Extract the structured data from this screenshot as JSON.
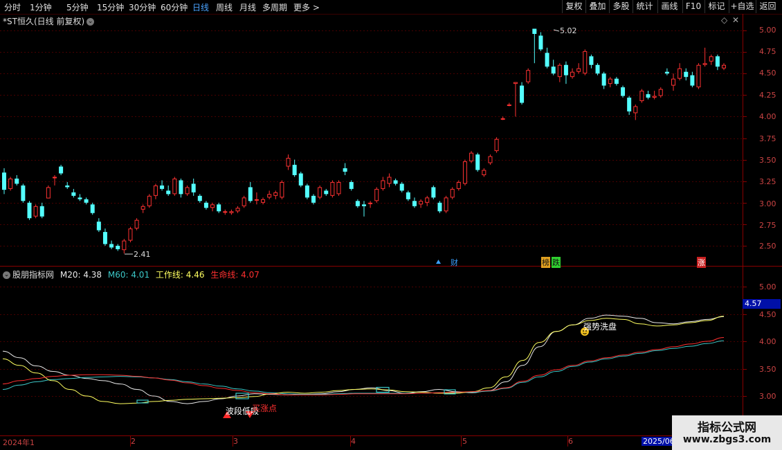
{
  "toolbar": {
    "tabs": [
      "分时",
      "1分钟",
      "5分钟",
      "15分钟",
      "30分钟",
      "60分钟",
      "日线",
      "周线",
      "月线",
      "多周期",
      "更多 >"
    ],
    "active_tab": "日线",
    "right_buttons": [
      "复权",
      "叠加",
      "多股",
      "统计",
      "画线",
      "F10",
      "标记",
      "+自选",
      "返回"
    ]
  },
  "chart_header": {
    "title": "*ST恒久(日线 前复权)",
    "right_icons": [
      "diamond-icon",
      "close-icon"
    ]
  },
  "price_axis": {
    "labels": [
      "5.00",
      "4.75",
      "4.50",
      "4.25",
      "4.00",
      "3.75",
      "3.50",
      "3.25",
      "3.00",
      "2.75",
      "2.50"
    ]
  },
  "indicator_axis": {
    "labels": [
      "5.00",
      "4.50",
      "4.00",
      "3.50",
      "3.00"
    ],
    "current_value": "4.57"
  },
  "annotations": {
    "high_label": "5.02",
    "low_label": "2.41",
    "events": [
      "财",
      "榜",
      "跌",
      "涨"
    ],
    "indicator_signals": [
      "强势洗盘",
      "波段低吸",
      "买涨点"
    ]
  },
  "indicator": {
    "name": "股朋指标网",
    "m20_label": "M20: 4.38",
    "m60_label": "M60: 4.01",
    "work_label": "工作线: 4.46",
    "life_label": "生命线: 4.07"
  },
  "date_axis": {
    "labels": [
      "2024年1",
      "2",
      "3",
      "4",
      "5",
      "6",
      "2025/06"
    ]
  },
  "watermark": {
    "title": "指标公式网",
    "url": "www.zbgs3.com"
  },
  "colors": {
    "up": "#ff3232",
    "down": "#54ffff",
    "bg": "#000000",
    "grid": "#4a0000",
    "m20": "#e8e8e8",
    "m60": "#3cc8c8",
    "work": "#ffff60",
    "life": "#ff3030"
  },
  "chart_data": {
    "type": "candlestick",
    "ylim": [
      2.4,
      5.1
    ],
    "candles": [
      {
        "o": 3.35,
        "h": 3.4,
        "l": 3.1,
        "c": 3.15
      },
      {
        "o": 3.16,
        "h": 3.3,
        "l": 3.14,
        "c": 3.28
      },
      {
        "o": 3.28,
        "h": 3.32,
        "l": 3.2,
        "c": 3.22
      },
      {
        "o": 3.2,
        "h": 3.22,
        "l": 3.0,
        "c": 3.02
      },
      {
        "o": 3.0,
        "h": 3.02,
        "l": 2.8,
        "c": 2.82
      },
      {
        "o": 2.84,
        "h": 2.98,
        "l": 2.82,
        "c": 2.96
      },
      {
        "o": 2.96,
        "h": 3.0,
        "l": 2.82,
        "c": 2.84
      },
      {
        "o": 3.05,
        "h": 3.2,
        "l": 3.05,
        "c": 3.18
      },
      {
        "o": 3.3,
        "h": 3.32,
        "l": 3.2,
        "c": 3.3
      },
      {
        "o": 3.42,
        "h": 3.44,
        "l": 3.32,
        "c": 3.34
      },
      {
        "o": 3.2,
        "h": 3.24,
        "l": 3.16,
        "c": 3.18
      },
      {
        "o": 3.12,
        "h": 3.16,
        "l": 3.06,
        "c": 3.08
      },
      {
        "o": 3.06,
        "h": 3.1,
        "l": 3.02,
        "c": 3.04
      },
      {
        "o": 3.04,
        "h": 3.06,
        "l": 2.98,
        "c": 3.0
      },
      {
        "o": 2.98,
        "h": 3.0,
        "l": 2.86,
        "c": 2.88
      },
      {
        "o": 2.78,
        "h": 2.82,
        "l": 2.66,
        "c": 2.68
      },
      {
        "o": 2.66,
        "h": 2.7,
        "l": 2.5,
        "c": 2.52
      },
      {
        "o": 2.52,
        "h": 2.56,
        "l": 2.46,
        "c": 2.48
      },
      {
        "o": 2.5,
        "h": 2.52,
        "l": 2.44,
        "c": 2.46
      },
      {
        "o": 2.45,
        "h": 2.58,
        "l": 2.41,
        "c": 2.56
      },
      {
        "o": 2.56,
        "h": 2.72,
        "l": 2.54,
        "c": 2.7
      },
      {
        "o": 2.7,
        "h": 2.82,
        "l": 2.68,
        "c": 2.8
      },
      {
        "o": 2.92,
        "h": 2.98,
        "l": 2.88,
        "c": 2.96
      },
      {
        "o": 2.96,
        "h": 3.1,
        "l": 2.94,
        "c": 3.08
      },
      {
        "o": 3.08,
        "h": 3.22,
        "l": 3.04,
        "c": 3.2
      },
      {
        "o": 3.2,
        "h": 3.26,
        "l": 3.14,
        "c": 3.16
      },
      {
        "o": 3.14,
        "h": 3.2,
        "l": 3.08,
        "c": 3.1
      },
      {
        "o": 3.1,
        "h": 3.3,
        "l": 3.08,
        "c": 3.28
      },
      {
        "o": 3.26,
        "h": 3.28,
        "l": 3.06,
        "c": 3.1
      },
      {
        "o": 3.1,
        "h": 3.2,
        "l": 3.08,
        "c": 3.18
      },
      {
        "o": 3.22,
        "h": 3.28,
        "l": 3.08,
        "c": 3.12
      },
      {
        "o": 3.08,
        "h": 3.1,
        "l": 3.0,
        "c": 3.02
      },
      {
        "o": 3.0,
        "h": 3.02,
        "l": 2.92,
        "c": 2.94
      },
      {
        "o": 2.94,
        "h": 3.0,
        "l": 2.9,
        "c": 2.98
      },
      {
        "o": 2.98,
        "h": 3.0,
        "l": 2.88,
        "c": 2.9
      },
      {
        "o": 2.9,
        "h": 2.92,
        "l": 2.86,
        "c": 2.9
      },
      {
        "o": 2.88,
        "h": 2.92,
        "l": 2.86,
        "c": 2.9
      },
      {
        "o": 2.9,
        "h": 2.96,
        "l": 2.88,
        "c": 2.94
      },
      {
        "o": 2.96,
        "h": 3.08,
        "l": 2.94,
        "c": 3.06
      },
      {
        "o": 3.18,
        "h": 3.24,
        "l": 3.0,
        "c": 3.02
      },
      {
        "o": 3.04,
        "h": 3.12,
        "l": 2.98,
        "c": 3.04
      },
      {
        "o": 3.0,
        "h": 3.06,
        "l": 2.98,
        "c": 3.04
      },
      {
        "o": 3.06,
        "h": 3.14,
        "l": 3.04,
        "c": 3.1
      },
      {
        "o": 3.08,
        "h": 3.14,
        "l": 3.04,
        "c": 3.12
      },
      {
        "o": 3.06,
        "h": 3.26,
        "l": 3.04,
        "c": 3.24
      },
      {
        "o": 3.42,
        "h": 3.56,
        "l": 3.38,
        "c": 3.52
      },
      {
        "o": 3.44,
        "h": 3.5,
        "l": 3.3,
        "c": 3.32
      },
      {
        "o": 3.34,
        "h": 3.36,
        "l": 3.18,
        "c": 3.2
      },
      {
        "o": 3.2,
        "h": 3.22,
        "l": 3.04,
        "c": 3.06
      },
      {
        "o": 3.08,
        "h": 3.1,
        "l": 2.98,
        "c": 3.0
      },
      {
        "o": 3.06,
        "h": 3.2,
        "l": 3.04,
        "c": 3.18
      },
      {
        "o": 3.14,
        "h": 3.16,
        "l": 3.08,
        "c": 3.1
      },
      {
        "o": 3.08,
        "h": 3.26,
        "l": 3.06,
        "c": 3.24
      },
      {
        "o": 3.1,
        "h": 3.26,
        "l": 3.08,
        "c": 3.24
      },
      {
        "o": 3.4,
        "h": 3.46,
        "l": 3.32,
        "c": 3.36
      },
      {
        "o": 3.24,
        "h": 3.26,
        "l": 3.14,
        "c": 3.16
      },
      {
        "o": 3.02,
        "h": 3.04,
        "l": 2.94,
        "c": 2.96
      },
      {
        "o": 2.98,
        "h": 3.02,
        "l": 2.84,
        "c": 2.96
      },
      {
        "o": 3.0,
        "h": 3.02,
        "l": 2.94,
        "c": 3.0
      },
      {
        "o": 3.02,
        "h": 3.18,
        "l": 3.0,
        "c": 3.16
      },
      {
        "o": 3.16,
        "h": 3.3,
        "l": 3.14,
        "c": 3.26
      },
      {
        "o": 3.22,
        "h": 3.34,
        "l": 3.18,
        "c": 3.3
      },
      {
        "o": 3.26,
        "h": 3.28,
        "l": 3.2,
        "c": 3.22
      },
      {
        "o": 3.22,
        "h": 3.24,
        "l": 3.12,
        "c": 3.14
      },
      {
        "o": 3.12,
        "h": 3.14,
        "l": 3.02,
        "c": 3.04
      },
      {
        "o": 3.02,
        "h": 3.06,
        "l": 2.94,
        "c": 2.96
      },
      {
        "o": 2.98,
        "h": 3.04,
        "l": 2.94,
        "c": 3.02
      },
      {
        "o": 3.0,
        "h": 3.08,
        "l": 2.96,
        "c": 3.06
      },
      {
        "o": 3.18,
        "h": 3.2,
        "l": 3.04,
        "c": 3.06
      },
      {
        "o": 3.0,
        "h": 3.02,
        "l": 2.88,
        "c": 2.9
      },
      {
        "o": 2.9,
        "h": 3.08,
        "l": 2.88,
        "c": 3.06
      },
      {
        "o": 3.06,
        "h": 3.18,
        "l": 3.04,
        "c": 3.16
      },
      {
        "o": 3.16,
        "h": 3.26,
        "l": 3.14,
        "c": 3.24
      },
      {
        "o": 3.22,
        "h": 3.5,
        "l": 3.2,
        "c": 3.48
      },
      {
        "o": 3.48,
        "h": 3.6,
        "l": 3.46,
        "c": 3.58
      },
      {
        "o": 3.56,
        "h": 3.58,
        "l": 3.36,
        "c": 3.38
      },
      {
        "o": 3.32,
        "h": 3.4,
        "l": 3.3,
        "c": 3.38
      },
      {
        "o": 3.46,
        "h": 3.56,
        "l": 3.44,
        "c": 3.54
      },
      {
        "o": 3.6,
        "h": 3.76,
        "l": 3.58,
        "c": 3.74
      },
      {
        "o": 3.98,
        "h": 4.0,
        "l": 3.96,
        "c": 3.98
      },
      {
        "o": 4.14,
        "h": 4.16,
        "l": 4.12,
        "c": 4.14
      },
      {
        "o": 4.38,
        "h": 4.4,
        "l": 4.0,
        "c": 4.4
      },
      {
        "o": 4.36,
        "h": 4.4,
        "l": 4.14,
        "c": 4.16
      },
      {
        "o": 4.4,
        "h": 4.56,
        "l": 4.38,
        "c": 4.54
      },
      {
        "o": 5.02,
        "h": 5.02,
        "l": 4.62,
        "c": 4.96
      },
      {
        "o": 4.94,
        "h": 4.98,
        "l": 4.76,
        "c": 4.78
      },
      {
        "o": 4.74,
        "h": 4.8,
        "l": 4.56,
        "c": 4.58
      },
      {
        "o": 4.58,
        "h": 4.66,
        "l": 4.48,
        "c": 4.5
      },
      {
        "o": 4.46,
        "h": 4.62,
        "l": 4.4,
        "c": 4.6
      },
      {
        "o": 4.6,
        "h": 4.64,
        "l": 4.38,
        "c": 4.48
      },
      {
        "o": 4.46,
        "h": 4.56,
        "l": 4.44,
        "c": 4.52
      },
      {
        "o": 4.52,
        "h": 4.62,
        "l": 4.5,
        "c": 4.56
      },
      {
        "o": 4.5,
        "h": 4.78,
        "l": 4.48,
        "c": 4.76
      },
      {
        "o": 4.7,
        "h": 4.72,
        "l": 4.56,
        "c": 4.6
      },
      {
        "o": 4.6,
        "h": 4.62,
        "l": 4.48,
        "c": 4.5
      },
      {
        "o": 4.5,
        "h": 4.52,
        "l": 4.32,
        "c": 4.36
      },
      {
        "o": 4.38,
        "h": 4.46,
        "l": 4.34,
        "c": 4.44
      },
      {
        "o": 4.44,
        "h": 4.46,
        "l": 4.36,
        "c": 4.38
      },
      {
        "o": 4.34,
        "h": 4.36,
        "l": 4.22,
        "c": 4.24
      },
      {
        "o": 4.22,
        "h": 4.24,
        "l": 4.02,
        "c": 4.06
      },
      {
        "o": 4.04,
        "h": 4.14,
        "l": 3.96,
        "c": 4.12
      },
      {
        "o": 4.18,
        "h": 4.32,
        "l": 4.16,
        "c": 4.3
      },
      {
        "o": 4.26,
        "h": 4.3,
        "l": 4.2,
        "c": 4.22
      },
      {
        "o": 4.22,
        "h": 4.3,
        "l": 4.2,
        "c": 4.24
      },
      {
        "o": 4.24,
        "h": 4.34,
        "l": 4.22,
        "c": 4.32
      },
      {
        "o": 4.52,
        "h": 4.56,
        "l": 4.48,
        "c": 4.5
      },
      {
        "o": 4.36,
        "h": 4.5,
        "l": 4.3,
        "c": 4.44
      },
      {
        "o": 4.44,
        "h": 4.62,
        "l": 4.42,
        "c": 4.56
      },
      {
        "o": 4.52,
        "h": 4.56,
        "l": 4.42,
        "c": 4.46
      },
      {
        "o": 4.48,
        "h": 4.52,
        "l": 4.34,
        "c": 4.36
      },
      {
        "o": 4.34,
        "h": 4.62,
        "l": 4.32,
        "c": 4.6
      },
      {
        "o": 4.6,
        "h": 4.8,
        "l": 4.58,
        "c": 4.62
      },
      {
        "o": 4.64,
        "h": 4.72,
        "l": 4.6,
        "c": 4.7
      },
      {
        "o": 4.7,
        "h": 4.72,
        "l": 4.54,
        "c": 4.58
      },
      {
        "o": 4.56,
        "h": 4.62,
        "l": 4.54,
        "c": 4.6
      }
    ],
    "indicator_ylim": [
      2.75,
      5.25
    ],
    "series": [
      {
        "name": "M20",
        "values": [
          3.82,
          3.7,
          3.55,
          3.45,
          3.38,
          3.32,
          3.28,
          3.22,
          3.12,
          3.0,
          2.9,
          2.86,
          2.9,
          2.95,
          3.0,
          3.04,
          3.03,
          3.02,
          3.03,
          3.04,
          3.08,
          3.12,
          3.15,
          3.1,
          3.05,
          3.08,
          3.12,
          3.08,
          3.06,
          3.1,
          3.26,
          3.56,
          3.9,
          4.18,
          4.3,
          4.42,
          4.48,
          4.46,
          4.42,
          4.34,
          4.32,
          4.36,
          4.4,
          4.45
        ]
      },
      {
        "name": "M60",
        "values": [
          3.12,
          3.2,
          3.26,
          3.3,
          3.32,
          3.34,
          3.35,
          3.36,
          3.35,
          3.33,
          3.3,
          3.26,
          3.22,
          3.18,
          3.13,
          3.09,
          3.06,
          3.04,
          3.03,
          3.03,
          3.04,
          3.05,
          3.05,
          3.05,
          3.05,
          3.05,
          3.06,
          3.06,
          3.07,
          3.09,
          3.14,
          3.25,
          3.35,
          3.45,
          3.54,
          3.62,
          3.68,
          3.73,
          3.78,
          3.83,
          3.87,
          3.91,
          3.96,
          4.01
        ]
      },
      {
        "name": "工作线",
        "values": [
          3.68,
          3.56,
          3.42,
          3.28,
          3.12,
          3.0,
          2.9,
          2.86,
          2.87,
          2.9,
          2.92,
          2.94,
          2.95,
          2.96,
          2.97,
          2.99,
          3.04,
          3.07,
          3.05,
          3.07,
          3.1,
          3.12,
          3.13,
          3.11,
          3.08,
          3.07,
          3.05,
          3.05,
          3.08,
          3.15,
          3.35,
          3.65,
          3.98,
          4.18,
          4.3,
          4.38,
          4.42,
          4.4,
          4.32,
          4.28,
          4.3,
          4.34,
          4.38,
          4.46
        ]
      },
      {
        "name": "生命线",
        "values": [
          3.22,
          3.28,
          3.32,
          3.36,
          3.38,
          3.39,
          3.39,
          3.38,
          3.36,
          3.33,
          3.29,
          3.24,
          3.19,
          3.14,
          3.1,
          3.06,
          3.04,
          3.02,
          3.02,
          3.02,
          3.03,
          3.04,
          3.04,
          3.04,
          3.04,
          3.05,
          3.06,
          3.07,
          3.08,
          3.1,
          3.15,
          3.27,
          3.38,
          3.48,
          3.56,
          3.64,
          3.7,
          3.75,
          3.8,
          3.85,
          3.9,
          3.95,
          4.0,
          4.07
        ]
      }
    ]
  }
}
